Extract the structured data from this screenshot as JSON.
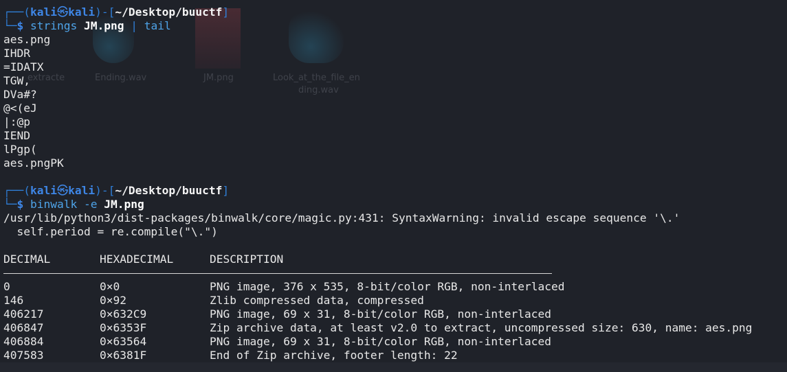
{
  "prompt": {
    "corner_top": "┌──(",
    "corner_bottom": "└─",
    "user": "kali",
    "at_icon": "kali-swirl-icon",
    "at": "㉿",
    "host": "kali",
    "mid": ")-[",
    "path": "~/Desktop/buuctf",
    "end": "]",
    "dollar": "$"
  },
  "commands": [
    {
      "program": "strings",
      "arg": "JM.png",
      "pipe": "|",
      "pipe_cmd": "tail",
      "output": [
        "aes.png",
        "IHDR",
        "=IDATX",
        "TGW,",
        "DVa#?",
        "@<(eJ",
        "|:@p",
        "IEND",
        "lPgp(",
        "aes.pngPK"
      ]
    },
    {
      "program": "binwalk",
      "flag": "-e",
      "arg": "JM.png",
      "warning_1": "/usr/lib/python3/dist-packages/binwalk/core/magic.py:431: SyntaxWarning: invalid escape sequence '\\.'",
      "warning_2": "  self.period = re.compile(\"\\.\")"
    }
  ],
  "results": {
    "headers": [
      "DECIMAL",
      "HEXADECIMAL",
      "DESCRIPTION"
    ],
    "rows": [
      [
        "0",
        "0×0",
        "PNG image, 376 x 535, 8-bit/color RGB, non-interlaced"
      ],
      [
        "146",
        "0×92",
        "Zlib compressed data, compressed"
      ],
      [
        "406217",
        "0×632C9",
        "PNG image, 69 x 31, 8-bit/color RGB, non-interlaced"
      ],
      [
        "406847",
        "0×6353F",
        "Zip archive data, at least v2.0 to extract, uncompressed size: 630, name: aes.png"
      ],
      [
        "406884",
        "0×63564",
        "PNG image, 69 x 31, 8-bit/color RGB, non-interlaced"
      ],
      [
        "407583",
        "0×6381F",
        "End of Zip archive, footer length: 22"
      ]
    ]
  },
  "desktop": {
    "labels": [
      "extracte",
      "Ending.wav",
      "JM.png",
      "Look_at_the_file_en",
      "ding.wav"
    ]
  },
  "colors": {
    "background": "#1f2229",
    "prompt_blue": "#2f7fd8",
    "command_blue": "#4ea3e8",
    "text": "#e8e8e8"
  }
}
